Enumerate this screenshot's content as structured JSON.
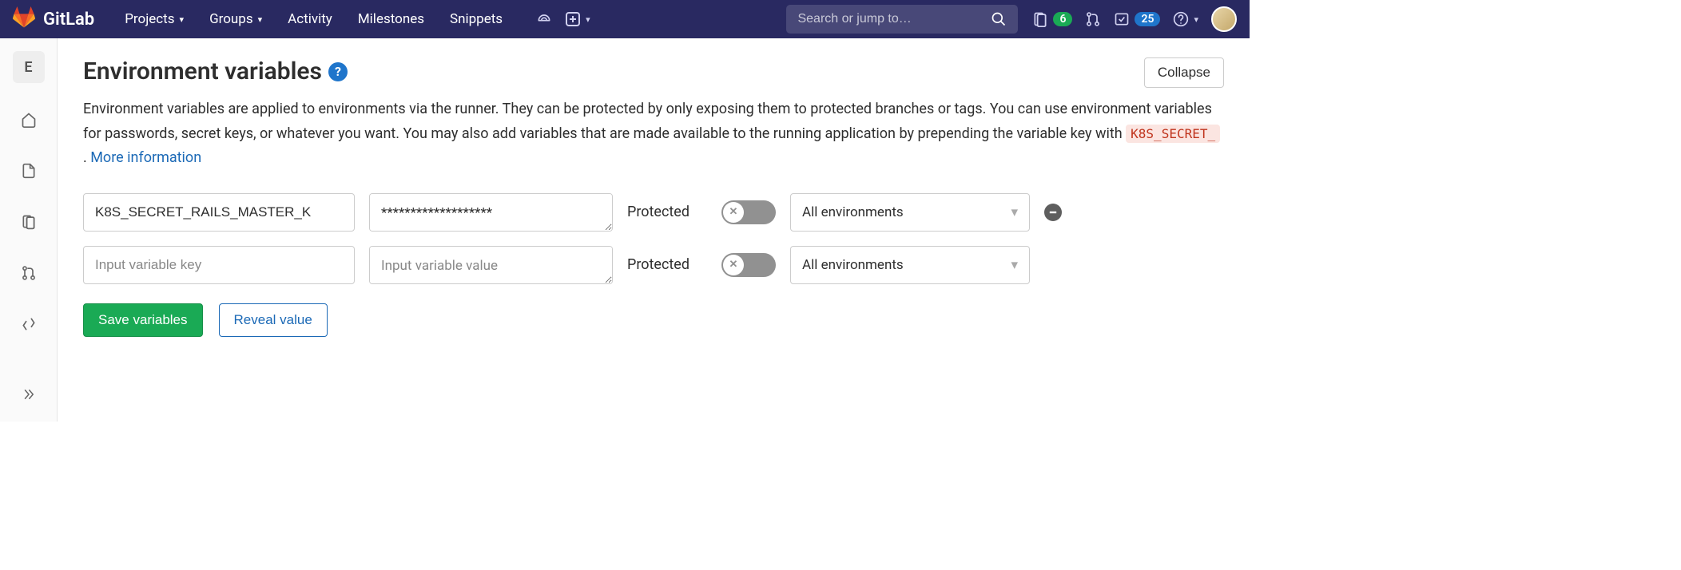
{
  "brand": {
    "name": "GitLab"
  },
  "nav": {
    "items": [
      {
        "label": "Projects",
        "caret": true
      },
      {
        "label": "Groups",
        "caret": true
      },
      {
        "label": "Activity",
        "caret": false
      },
      {
        "label": "Milestones",
        "caret": false
      },
      {
        "label": "Snippets",
        "caret": false
      }
    ],
    "search_placeholder": "Search or jump to…",
    "issues_count": "6",
    "todos_count": "25"
  },
  "sidebar": {
    "project_letter": "E"
  },
  "section": {
    "title": "Environment variables",
    "collapse_label": "Collapse",
    "description_prefix": "Environment variables are applied to environments via the runner. They can be protected by only exposing them to protected branches or tags. You can use environment variables for passwords, secret keys, or whatever you want. You may also add variables that are made available to the running application by prepending the variable key with ",
    "description_code": "K8S_SECRET_",
    "description_suffix": " . ",
    "more_info": "More information"
  },
  "variables": [
    {
      "key": "K8S_SECRET_RAILS_MASTER_K",
      "value": "*******************",
      "protected_label": "Protected",
      "protected": false,
      "environment": "All environments"
    },
    {
      "key": "",
      "value": "",
      "key_placeholder": "Input variable key",
      "value_placeholder": "Input variable value",
      "protected_label": "Protected",
      "protected": false,
      "environment": "All environments"
    }
  ],
  "actions": {
    "save": "Save variables",
    "reveal": "Reveal value"
  }
}
